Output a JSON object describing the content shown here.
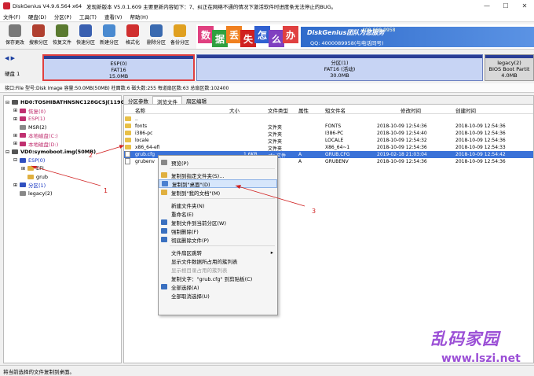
{
  "window": {
    "title": "DiskGenius V4.9.6.564 x64",
    "notice": "发现新版本 V5.0.1.609 主要更新内容如下：7、纠正在网络不通的情况下激活软件时进度条无法停止的BUG。",
    "controls": [
      "—",
      "☐",
      "✕"
    ]
  },
  "menu": [
    "文件(F)",
    "硬盘(D)",
    "分区(P)",
    "工具(T)",
    "查看(V)",
    "帮助(H)"
  ],
  "toolbar": [
    {
      "label": "保存更改",
      "icon": "save-icon",
      "color": "#7a7a7a"
    },
    {
      "label": "搜索分区",
      "icon": "search-icon",
      "color": "#b04030"
    },
    {
      "label": "恢复文件",
      "icon": "restore-icon",
      "color": "#5a7a30"
    },
    {
      "label": "快速分区",
      "icon": "quick-partition-icon",
      "color": "#3a60b0"
    },
    {
      "label": "新建分区",
      "icon": "new-partition-icon",
      "color": "#4a8ad0"
    },
    {
      "label": "格式化",
      "icon": "format-icon",
      "color": "#d03030"
    },
    {
      "label": "删除分区",
      "icon": "delete-partition-icon",
      "color": "#3a6ab0"
    },
    {
      "label": "备份分区",
      "icon": "backup-icon",
      "color": "#e0a020"
    }
  ],
  "banner": {
    "chars": [
      "数",
      "据",
      "丢",
      "失",
      "怎",
      "么",
      "办"
    ],
    "char_colors": [
      "#e04080",
      "#30a040",
      "#f08020",
      "#d02020",
      "#3060d0",
      "#8040c0",
      "#e04040"
    ],
    "brand": "DiskGenius团队为您服务",
    "phone": "400-008-9958",
    "qq": "QQ: 4000089958(与电话同号)"
  },
  "disk_map": {
    "disk_label": "硬盘 1",
    "partitions": [
      {
        "name": "ESP(0)",
        "fs": "FAT16",
        "size": "15.0MB"
      },
      {
        "name": "分区(1)",
        "fs": "FAT16 (活动)",
        "size": "30.0MB"
      },
      {
        "name": "legacy(2)",
        "fs": "BIOS Boot Partit",
        "size": "4.0MB"
      }
    ]
  },
  "disk_info": "接口:File  型号:Disk Image  容量:50.0MB(50MB)  柱面数:6  磁头数:255  每道扇区数:63  总扇区数:102400",
  "tree": [
    {
      "label": "HD0:TOSHIBATHNSNC128GCSJ(119GB)",
      "style": "bold",
      "expander": "⊟"
    },
    {
      "label": "恢复(0)",
      "style": "pink",
      "expander": "⊞"
    },
    {
      "label": "ESP(1)",
      "style": "pink",
      "expander": "⊞"
    },
    {
      "label": "MSR(2)",
      "style": "",
      "expander": ""
    },
    {
      "label": "本地磁盘(C:)",
      "style": "pink",
      "expander": "⊞"
    },
    {
      "label": "本地磁盘(D:)",
      "style": "pink",
      "expander": "⊞"
    },
    {
      "label": "VD0:symoboot.img(50MB)",
      "style": "bold",
      "expander": "⊟"
    },
    {
      "label": "ESP(0)",
      "style": "blue",
      "expander": "⊟"
    },
    {
      "label": "EFI",
      "style": "",
      "expander": "⊞"
    },
    {
      "label": "grub",
      "style": "",
      "expander": ""
    },
    {
      "label": "分区(1)",
      "style": "blue",
      "expander": "⊞"
    },
    {
      "label": "legacy(2)",
      "style": "",
      "expander": ""
    }
  ],
  "tabs": [
    "分区参数",
    "浏览文件",
    "扇区编辑"
  ],
  "columns": [
    "名称",
    "大小",
    "文件类型",
    "属性",
    "短文件名",
    "修改时间",
    "创建时间"
  ],
  "files": [
    {
      "name": "..",
      "size": "",
      "type": "",
      "attr": "",
      "short": "",
      "mtime": "",
      "ctime": "",
      "kind": "folder"
    },
    {
      "name": "fonts",
      "size": "",
      "type": "文件夹",
      "attr": "",
      "short": "FONTS",
      "mtime": "2018-10-09 12:54:36",
      "ctime": "2018-10-09 12:54:36",
      "kind": "folder"
    },
    {
      "name": "i386-pc",
      "size": "",
      "type": "文件夹",
      "attr": "",
      "short": "I386-PC",
      "mtime": "2018-10-09 12:54:40",
      "ctime": "2018-10-09 12:54:36",
      "kind": "folder"
    },
    {
      "name": "locale",
      "size": "",
      "type": "文件夹",
      "attr": "",
      "short": "LOCALE",
      "mtime": "2018-10-09 12:54:32",
      "ctime": "2018-10-09 12:54:36",
      "kind": "folder"
    },
    {
      "name": "x86_64-efi",
      "size": "",
      "type": "文件夹",
      "attr": "",
      "short": "X86_64~1",
      "mtime": "2018-10-09 12:54:36",
      "ctime": "2018-10-09 12:54:33",
      "kind": "folder"
    },
    {
      "name": "grub.cfg",
      "size": "1.6KB",
      "type": "cfg 文件",
      "attr": "A",
      "short": "GRUB.CFG",
      "mtime": "2019-02-18 21:03:04",
      "ctime": "2018-10-09 12:54:42",
      "kind": "file"
    },
    {
      "name": "grubenv",
      "size": "",
      "type": "",
      "attr": "A",
      "short": "GRUBENV",
      "mtime": "2018-10-09 12:54:36",
      "ctime": "2018-10-09 12:54:36",
      "kind": "file"
    }
  ],
  "context_menu": [
    {
      "label": "预览(P)",
      "icon": "preview-icon",
      "color": "#888",
      "state": "normal"
    },
    {
      "sep": true
    },
    {
      "label": "复制到指定文件夹(S)...",
      "icon": "copy-folder-icon",
      "color": "#e0b040",
      "state": "normal"
    },
    {
      "label": "复制到\"桌面\"(D)",
      "icon": "desktop-icon",
      "color": "#4a80d0",
      "state": "highlight"
    },
    {
      "label": "复制到\"我的文档\"(M)",
      "icon": "documents-icon",
      "color": "#e0b040",
      "state": "normal"
    },
    {
      "sep": true
    },
    {
      "label": "新建文件夹(N)",
      "icon": "",
      "color": "",
      "state": "normal"
    },
    {
      "label": "重命名(E)",
      "icon": "",
      "color": "",
      "state": "normal"
    },
    {
      "label": "复制文件到当前分区(W)",
      "icon": "copy-icon",
      "color": "#3a70c0",
      "state": "normal"
    },
    {
      "label": "强制删除(F)",
      "icon": "force-delete-icon",
      "color": "#3a70c0",
      "state": "normal"
    },
    {
      "label": "彻底删除文件(P)",
      "icon": "wipe-icon",
      "color": "#3a70c0",
      "state": "normal"
    },
    {
      "sep": true
    },
    {
      "label": "文件扇区跳转",
      "icon": "",
      "color": "",
      "state": "submenu"
    },
    {
      "label": "显示文件数据所占用的簇列表",
      "icon": "",
      "color": "",
      "state": "normal"
    },
    {
      "label": "显示根目录占用的簇列表",
      "icon": "",
      "color": "",
      "state": "disabled"
    },
    {
      "label": "复制文字：\"grub.cfg\" 到剪贴板(C)",
      "icon": "",
      "color": "",
      "state": "normal"
    },
    {
      "label": "全部选择(A)",
      "icon": "select-all-icon",
      "color": "#3a70c0",
      "state": "normal"
    },
    {
      "label": "全部取消选择(U)",
      "icon": "",
      "color": "",
      "state": "normal"
    }
  ],
  "status": "将当前选择的文件复制到桌面。",
  "annotations": [
    "1",
    "2",
    "3"
  ],
  "watermark": {
    "title": "乱码家园",
    "url": "www.lszi.net"
  }
}
